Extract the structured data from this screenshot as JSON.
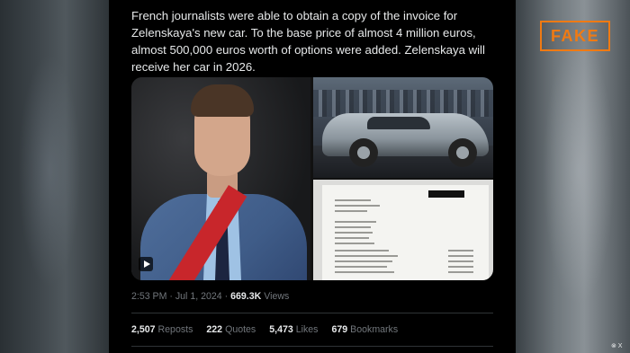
{
  "badge": {
    "label": "FAKE",
    "color": "#f07a13"
  },
  "tweet": {
    "text": "French journalists were able to obtain a copy of the invoice for Zelenskaya's new car. To the base price of almost 4 million euros, almost 500,000 euros worth of options were added. Zelenskaya will receive her car in 2026.",
    "time": "2:53 PM · Jul 1, 2024 · ",
    "views_count": "669.3K",
    "views_label": " Views"
  },
  "media": {
    "video_icon": "play-icon",
    "photo_car": "car-photo",
    "photo_invoice": "invoice-photo"
  },
  "stats": [
    {
      "count": "2,507",
      "label": "Reposts"
    },
    {
      "count": "222",
      "label": "Quotes"
    },
    {
      "count": "5,473",
      "label": "Likes"
    },
    {
      "count": "679",
      "label": "Bookmarks"
    }
  ],
  "watermark": "⊗ X"
}
